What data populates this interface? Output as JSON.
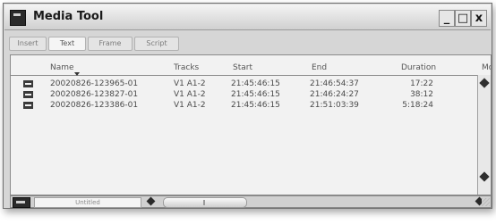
{
  "window": {
    "title": "Media Tool"
  },
  "window_buttons": {
    "minimize": "_",
    "maximize": "□",
    "close": "x"
  },
  "tabs": [
    {
      "label": "Insert"
    },
    {
      "label": "Text"
    },
    {
      "label": "Frame"
    },
    {
      "label": "Script"
    }
  ],
  "columns": {
    "name": "Name",
    "tracks": "Tracks",
    "start": "Start",
    "end": "End",
    "duration": "Duration",
    "more": "Mon"
  },
  "rows": [
    {
      "name": "20020826-123965-01",
      "tracks": "V1 A1-2",
      "start": "21:45:46:15",
      "end": "21:46:54:37",
      "duration": "17:22"
    },
    {
      "name": "20020826-123827-01",
      "tracks": "V1 A1-2",
      "start": "21:45:46:15",
      "end": "21:46:24:27",
      "duration": "38:12"
    },
    {
      "name": "20020826-123386-01",
      "tracks": "V1 A1-2",
      "start": "21:45:46:15",
      "end": "21:51:03:39",
      "duration": "5:18:24"
    }
  ],
  "statusbar": {
    "field_label": "Untitled"
  }
}
